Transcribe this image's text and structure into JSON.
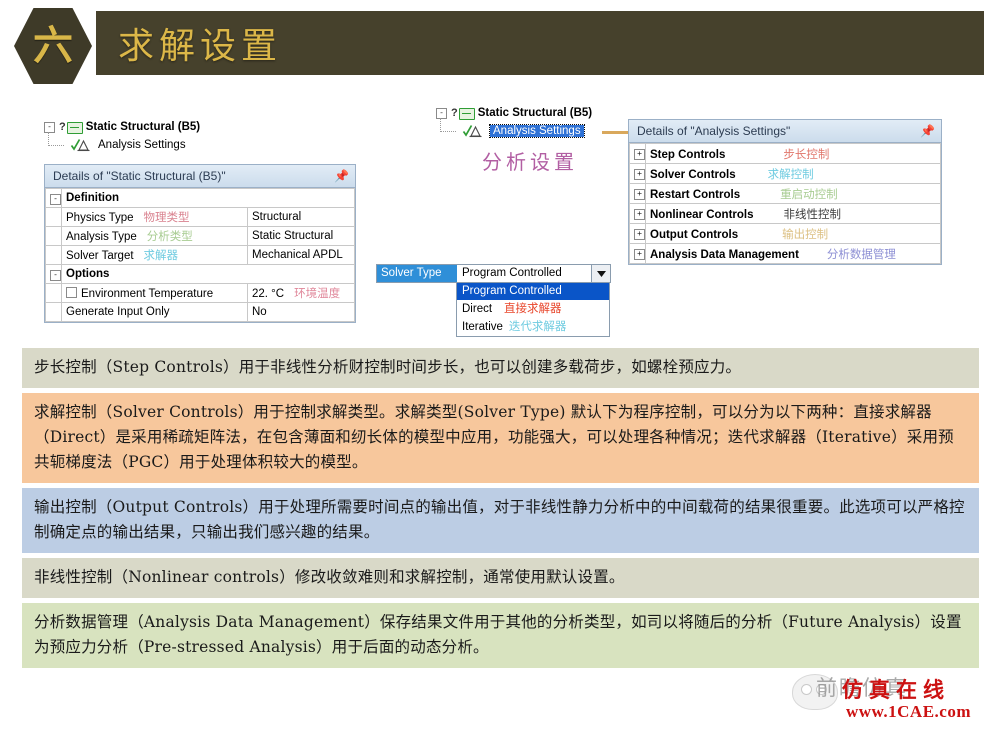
{
  "header": {
    "badge": "六",
    "title": "求解设置",
    "badge_color": "#3e3a28",
    "title_bar_color": "#46412c",
    "title_text_color": "#dcb748"
  },
  "left_tree": {
    "expander": "-",
    "question_mark": "?",
    "root_label": "Static Structural (B5)",
    "child_label": "Analysis Settings",
    "root_icon": "folder-icon",
    "child_icon": "analysis-settings-icon"
  },
  "left_panel": {
    "title": "Details of \"Static Structural (B5)\"",
    "pin_icon": "pushpin-icon",
    "rows": [
      {
        "kind": "section",
        "expander": "-",
        "name": "Definition",
        "cn": "",
        "cn_color": "",
        "value": ""
      },
      {
        "kind": "prop",
        "name": "Physics Type",
        "cn": "物理类型",
        "cn_color": "#d9828f",
        "value": "Structural"
      },
      {
        "kind": "prop",
        "name": "Analysis Type",
        "cn": "分析类型",
        "cn_color": "#a8cc92",
        "value": "Static Structural"
      },
      {
        "kind": "prop",
        "name": "Solver Target",
        "cn": "求解器",
        "cn_color": "#6ecbe0",
        "value": "Mechanical APDL"
      },
      {
        "kind": "section",
        "expander": "-",
        "name": "Options",
        "cn": "",
        "cn_color": "",
        "value": ""
      },
      {
        "kind": "check",
        "name": "Environment Temperature",
        "cn": "环境温度",
        "cn_color": "#e0879a",
        "value": "22. °C"
      },
      {
        "kind": "prop_noindent",
        "name": "Generate Input Only",
        "cn": "",
        "cn_color": "",
        "value": "No"
      }
    ]
  },
  "middle_tree": {
    "expander": "-",
    "question_mark": "?",
    "root_label": "Static Structural (B5)",
    "selected_label": "Analysis Settings",
    "annotation": "分析设置",
    "annotation_color": "#b25fa3",
    "selection_color": "#2f72d6"
  },
  "solver_type": {
    "label": "Solver Type",
    "label_bg": "#2f8fd8",
    "selected_value": "Program Controlled",
    "dropdown_arrow_icon": "chevron-down-icon",
    "options": [
      {
        "label": "Program Controlled",
        "cn": "",
        "cn_color": "",
        "selected": true
      },
      {
        "label": "Direct",
        "cn": "直接求解器",
        "cn_color": "#e8452a",
        "selected": false
      },
      {
        "label": "Iterative",
        "cn": "迭代求解器",
        "cn_color": "#6ecbe0",
        "selected": false
      }
    ]
  },
  "right_panel": {
    "title": "Details of \"Analysis Settings\"",
    "pin_icon": "pushpin-icon",
    "rows": [
      {
        "expander": "+",
        "name": "Step Controls",
        "cn": "步长控制",
        "cn_color": "#e0756a",
        "cn_indent": 58
      },
      {
        "expander": "+",
        "name": "Solver Controls",
        "cn": "求解控制",
        "cn_color": "#6ecbe0",
        "cn_indent": 32
      },
      {
        "expander": "+",
        "name": "Restart Controls",
        "cn": "重启动控制",
        "cn_color": "#a8cc92",
        "cn_indent": 40
      },
      {
        "expander": "+",
        "name": "Nonlinear Controls",
        "cn": "非线性控制",
        "cn_color": "#3c3c3c",
        "cn_indent": 30
      },
      {
        "expander": "+",
        "name": "Output Controls",
        "cn": "输出控制",
        "cn_color": "#dcc083",
        "cn_indent": 44
      },
      {
        "expander": "+",
        "name": "Analysis Data Management",
        "cn": "分析数据管理",
        "cn_color": "#8d8fd4",
        "cn_indent": 28
      }
    ]
  },
  "notes": [
    {
      "id": "step-controls-note",
      "bg": "#d9d9c8",
      "text": "步长控制（Step Controls）用于非线性分析财控制时间步长，也可以创建多载荷步，如螺栓预应力。"
    },
    {
      "id": "solver-controls-note",
      "bg": "#f7c79c",
      "text": "求解控制（Solver Controls）用于控制求解类型。求解类型(Solver Type) 默认下为程序控制，可以分为以下两种：直接求解器（Direct）是采用稀疏矩阵法，在包含薄面和纫长体的模型中应用，功能强大，可以处理各种情况；迭代求解器（Iterative）采用预共轭梯度法（PGC）用于处理体积较大的模型。"
    },
    {
      "id": "output-controls-note",
      "bg": "#bccde4",
      "text": "输出控制（Output Controls）用于处理所需要时间点的输出值，对于非线性静力分析中的中间载荷的结果很重要。此选项可以严格控制确定点的输出结果，只输出我们感兴趣的结果。"
    },
    {
      "id": "nonlinear-controls-note",
      "bg": "#d9d9c8",
      "text": "非线性控制（Nonlinear controls）修改收敛难则和求解控制，通常使用默认设置。"
    },
    {
      "id": "analysis-data-management-note",
      "bg": "#d8e3bf",
      "text": "分析数据管理（Analysis Data Management）保存结果文件用于其他的分析类型，如司以将随后的分析（Future Analysis）设置为预应力分析（Pre-stressed Analysis）用于后面的动态分析。"
    }
  ],
  "watermark": {
    "text_gray": "前瞻仿真",
    "text_red": "仿真在线",
    "url": "www.1CAE.com",
    "red": "#cc1111"
  }
}
